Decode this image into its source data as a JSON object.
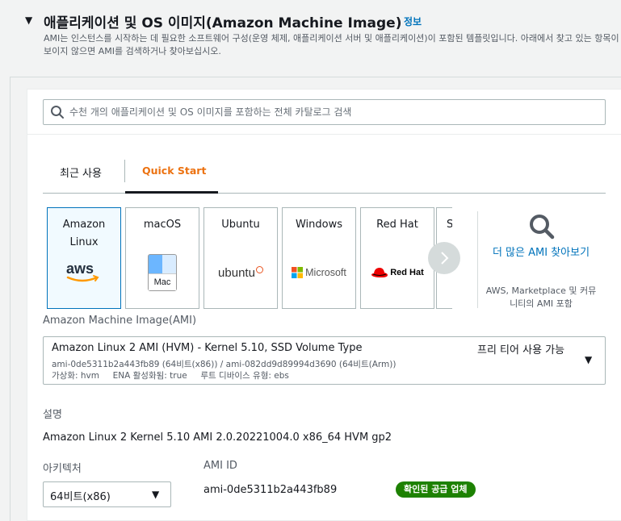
{
  "section": {
    "title": "애플리케이션 및 OS 이미지(Amazon Machine Image)",
    "info_link": "정보",
    "description": "AMI는 인스턴스를 시작하는 데 필요한 소프트웨어 구성(운영 체제, 애플리케이션 서버 및 애플리케이션)이 포함된 템플릿입니다. 아래에서 찾고 있는 항목이 보이지 않으면 AMI를 검색하거나 찾아보십시오."
  },
  "search": {
    "placeholder": "수천 개의 애플리케이션 및 OS 이미지를 포함하는 전체 카탈로그 검색",
    "value": ""
  },
  "tabs": [
    {
      "label": "최근 사용",
      "active": false
    },
    {
      "label": "Quick Start",
      "active": true
    }
  ],
  "os_cards": [
    {
      "label": "Amazon Linux",
      "logo": "aws-logo",
      "selected": true
    },
    {
      "label": "macOS",
      "logo": "mac-finder-logo",
      "logo_text": "Mac",
      "selected": false
    },
    {
      "label": "Ubuntu",
      "logo": "ubuntu-logo",
      "logo_text": "ubuntu",
      "selected": false
    },
    {
      "label": "Windows",
      "logo": "microsoft-logo",
      "logo_text": "Microsoft",
      "selected": false
    },
    {
      "label": "Red Hat",
      "logo": "redhat-logo",
      "logo_text": "Red Hat",
      "selected": false
    },
    {
      "label": "S",
      "logo": "",
      "selected": false
    }
  ],
  "more_amis": {
    "link": "더 많은 AMI 찾아보기",
    "sub": "AWS, Marketplace 및 커뮤니티의 AMI 포함"
  },
  "ami": {
    "label": "Amazon Machine Image(AMI)",
    "name": "Amazon Linux 2 AMI (HVM) - Kernel 5.10, SSD Volume Type",
    "tier": "프리 티어 사용 가능",
    "ids": "ami-0de5311b2a443fb89 (64비트(x86)) / ami-082dd9d89994d3690 (64비트(Arm))",
    "meta": "가상화: hvm     ENA 활성화됨: true     루트 디바이스 유형: ebs"
  },
  "details": {
    "desc_label": "설명",
    "desc_value": "Amazon Linux 2 Kernel 5.10 AMI 2.0.20221004.0 x86_64 HVM gp2",
    "arch_label": "아키텍처",
    "arch_value": "64비트(x86)",
    "amiid_label": "AMI ID",
    "amiid_value": "ami-0de5311b2a443fb89",
    "badge": "확인된 공급 업체"
  },
  "colors": {
    "accent": "#ec7211",
    "link": "#0073bb",
    "badge": "#1d8102",
    "selected_bg": "#f1faff"
  }
}
